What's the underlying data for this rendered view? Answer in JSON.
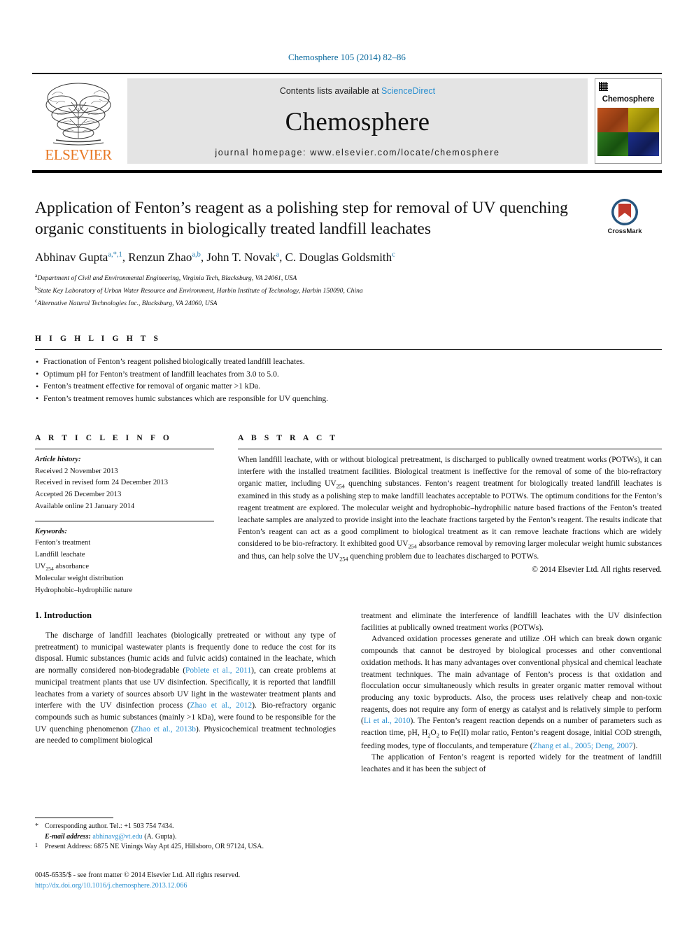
{
  "running_head": "Chemosphere 105 (2014) 82–86",
  "masthead": {
    "publisher": "ELSEVIER",
    "contents_prefix": "Contents lists available at ",
    "sciencedirect": "ScienceDirect",
    "journal_name": "Chemosphere",
    "homepage": "journal homepage: www.elsevier.com/locate/chemosphere",
    "cover_title": "Chemosphere"
  },
  "article": {
    "title": "Application of Fenton’s reagent as a polishing step for removal of UV quenching organic constituents in biologically treated landfill leachates",
    "authors": [
      {
        "name": "Abhinav Gupta",
        "marks": "a,*,1"
      },
      {
        "name": "Renzun Zhao",
        "marks": "a,b"
      },
      {
        "name": "John T. Novak",
        "marks": "a"
      },
      {
        "name": "C. Douglas Goldsmith",
        "marks": "c"
      }
    ],
    "affiliations": [
      {
        "label": "a",
        "text": "Department of Civil and Environmental Engineering, Virginia Tech, Blacksburg, VA 24061, USA"
      },
      {
        "label": "b",
        "text": "State Key Laboratory of Urban Water Resource and Environment, Harbin Institute of Technology, Harbin 150090, China"
      },
      {
        "label": "c",
        "text": "Alternative Natural Technologies Inc., Blacksburg, VA 24060, USA"
      }
    ]
  },
  "crossmark": {
    "label": "CrossMark"
  },
  "highlights": {
    "heading": "H I G H L I G H T S",
    "items": [
      "Fractionation of Fenton’s reagent polished biologically treated landfill leachates.",
      "Optimum pH for Fenton’s treatment of landfill leachates from 3.0 to 5.0.",
      "Fenton’s treatment effective for removal of organic matter >1 kDa.",
      "Fenton’s treatment removes humic substances which are responsible for UV quenching."
    ]
  },
  "article_info": {
    "heading": "A R T I C L E   I N F O",
    "history_label": "Article history:",
    "history": [
      "Received 2 November 2013",
      "Received in revised form 24 December 2013",
      "Accepted 26 December 2013",
      "Available online 21 January 2014"
    ],
    "keywords_label": "Keywords:",
    "keywords": [
      "Fenton’s treatment",
      "Landfill leachate",
      "UV254 absorbance",
      "Molecular weight distribution",
      "Hydrophobic–hydrophilic nature"
    ]
  },
  "abstract": {
    "heading": "A B S T R A C T",
    "text": "When landfill leachate, with or without biological pretreatment, is discharged to publically owned treatment works (POTWs), it can interfere with the installed treatment facilities. Biological treatment is ineffective for the removal of some of the bio-refractory organic matter, including UV254 quenching substances. Fenton’s reagent treatment for biologically treated landfill leachates is examined in this study as a polishing step to make landfill leachates acceptable to POTWs. The optimum conditions for the Fenton’s reagent treatment are explored. The molecular weight and hydrophobic–hydrophilic nature based fractions of the Fenton’s treated leachate samples are analyzed to provide insight into the leachate fractions targeted by the Fenton’s reagent. The results indicate that Fenton’s reagent can act as a good compliment to biological treatment as it can remove leachate fractions which are widely considered to be bio-refractory. It exhibited good UV254 absorbance removal by removing larger molecular weight humic substances and thus, can help solve the UV254 quenching problem due to leachates discharged to POTWs.",
    "copyright": "© 2014 Elsevier Ltd. All rights reserved."
  },
  "body": {
    "section_title": "1. Introduction",
    "left_paragraph_1_parts": [
      "The discharge of landfill leachates (biologically pretreated or without any type of pretreatment) to municipal wastewater plants is frequently done to reduce the cost for its disposal. Humic substances (humic acids and fulvic acids) contained in the leachate, which are normally considered non-biodegradable (",
      "Poblete et al., 2011",
      "), can create problems at municipal treatment plants that use UV disinfection. Specifically, it is reported that landfill leachates from a variety of sources absorb UV light in the wastewater treatment plants and interfere with the UV disinfection process (",
      "Zhao et al., 2012",
      "). Bio-refractory organic compounds such as humic substances (mainly >1 kDa), were found to be responsible for the UV quenching phenomenon (",
      "Zhao et al., 2013b",
      "). Physicochemical treatment technologies are needed to compliment biological"
    ],
    "right_paragraph_1": "treatment and eliminate the interference of landfill leachates with the UV disinfection facilities at publically owned treatment works (POTWs).",
    "right_paragraph_2_parts": [
      "Advanced oxidation processes generate and utilize .OH which can break down organic compounds that cannot be destroyed by biological processes and other conventional oxidation methods. It has many advantages over conventional physical and chemical leachate treatment techniques. The main advantage of Fenton’s process is that oxidation and flocculation occur simultaneously which results in greater organic matter removal without producing any toxic byproducts. Also, the process uses relatively cheap and non-toxic reagents, does not require any form of energy as catalyst and is relatively simple to perform (",
      "Li et al., 2010",
      "). The Fenton’s reagent reaction depends on a number of parameters such as reaction time, pH, H2O2 to Fe(II) molar ratio, Fenton’s reagent dosage, initial COD strength, feeding modes, type of flocculants, and temperature (",
      "Zhang et al., 2005; Deng, 2007",
      ")."
    ],
    "right_paragraph_3": "The application of Fenton’s reagent is reported widely for the treatment of landfill leachates and it has been the subject of"
  },
  "footnotes": {
    "corresponding_marker": "*",
    "corresponding": "Corresponding author. Tel.: +1 503 754 7434.",
    "email_label": "E-mail address:",
    "email": "abhinavg@vt.edu",
    "email_suffix": "(A. Gupta).",
    "present_marker": "1",
    "present_address": "Present Address: 6875 NE Vinings Way Apt 425, Hillsboro, OR 97124, USA."
  },
  "imprint": {
    "issn_line": "0045-6535/$ - see front matter © 2014 Elsevier Ltd. All rights reserved.",
    "doi": "http://dx.doi.org/10.1016/j.chemosphere.2013.12.066"
  }
}
